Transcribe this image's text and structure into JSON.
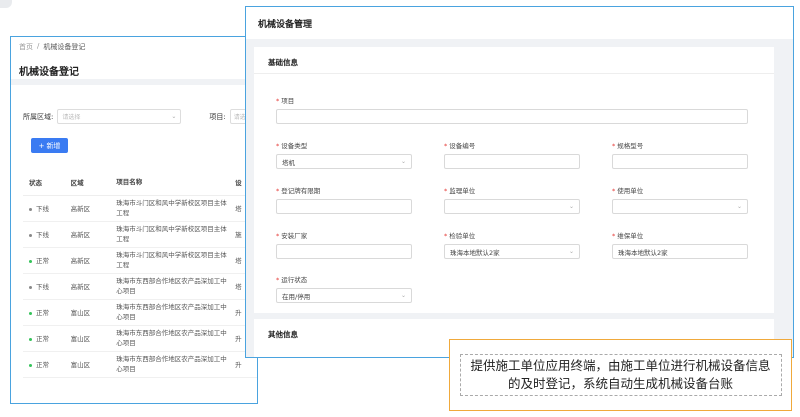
{
  "back_panel": {
    "breadcrumb": {
      "home": "首页",
      "sep": "/",
      "current": "机械设备登记"
    },
    "title": "机械设备登记",
    "filter": {
      "region_label": "所属区域:",
      "region_placeholder": "请选择",
      "project_label": "项目:",
      "project_placeholder": "请选"
    },
    "add_button": {
      "icon": "+",
      "label": "新增"
    },
    "table": {
      "headers": [
        "状态",
        "区域",
        "项目名称",
        "设"
      ],
      "rows": [
        {
          "status": "下线",
          "state": "off",
          "region": "高新区",
          "project": "珠海市斗门区和风中学新校区项目主体工程",
          "extra": "塔"
        },
        {
          "status": "下线",
          "state": "off",
          "region": "高新区",
          "project": "珠海市斗门区和风中学新校区项目主体工程",
          "extra": "施"
        },
        {
          "status": "正常",
          "state": "on",
          "region": "高新区",
          "project": "珠海市斗门区和风中学新校区项目主体工程",
          "extra": "塔"
        },
        {
          "status": "下线",
          "state": "off",
          "region": "高新区",
          "project": "珠海市东西部合作地区农产品深加工中心项目",
          "extra": "塔"
        },
        {
          "status": "正常",
          "state": "on",
          "region": "富山区",
          "project": "珠海市东西部合作地区农产品深加工中心项目",
          "extra": "升"
        },
        {
          "status": "正常",
          "state": "on",
          "region": "富山区",
          "project": "珠海市东西部合作地区农产品深加工中心项目",
          "extra": "升"
        },
        {
          "status": "正常",
          "state": "on",
          "region": "富山区",
          "project": "珠海市东西部合作地区农产品深加工中心项目",
          "extra": "升"
        }
      ]
    }
  },
  "front_panel": {
    "title": "机械设备管理",
    "basic_section": "基础信息",
    "other_section": "其他信息",
    "fields": {
      "project": {
        "label": "项目",
        "value": ""
      },
      "device_type": {
        "label": "设备类型",
        "value": "塔机"
      },
      "device_no": {
        "label": "设备编号",
        "value": ""
      },
      "model": {
        "label": "规格型号",
        "value": ""
      },
      "reg_expiry": {
        "label": "登记牌有限期",
        "value": ""
      },
      "supervisor": {
        "label": "监理单位",
        "value": ""
      },
      "user_unit": {
        "label": "使用单位",
        "value": ""
      },
      "installer": {
        "label": "安装厂家",
        "value": ""
      },
      "inspector": {
        "label": "检验单位",
        "value": "珠海本地默认2家"
      },
      "maintainer": {
        "label": "维保单位",
        "value": "珠海本地默认2家"
      },
      "run_status": {
        "label": "运行状态",
        "value": "在用/停用"
      }
    }
  },
  "caption": "提供施工单位应用终端，由施工单位进行机械设备信息的及时登记，系统自动生成机械设备台账",
  "colors": {
    "accent": "#3a7bf2",
    "frame": "#4aa3df",
    "caption_border": "#f0a93b",
    "required": "#e53935"
  }
}
